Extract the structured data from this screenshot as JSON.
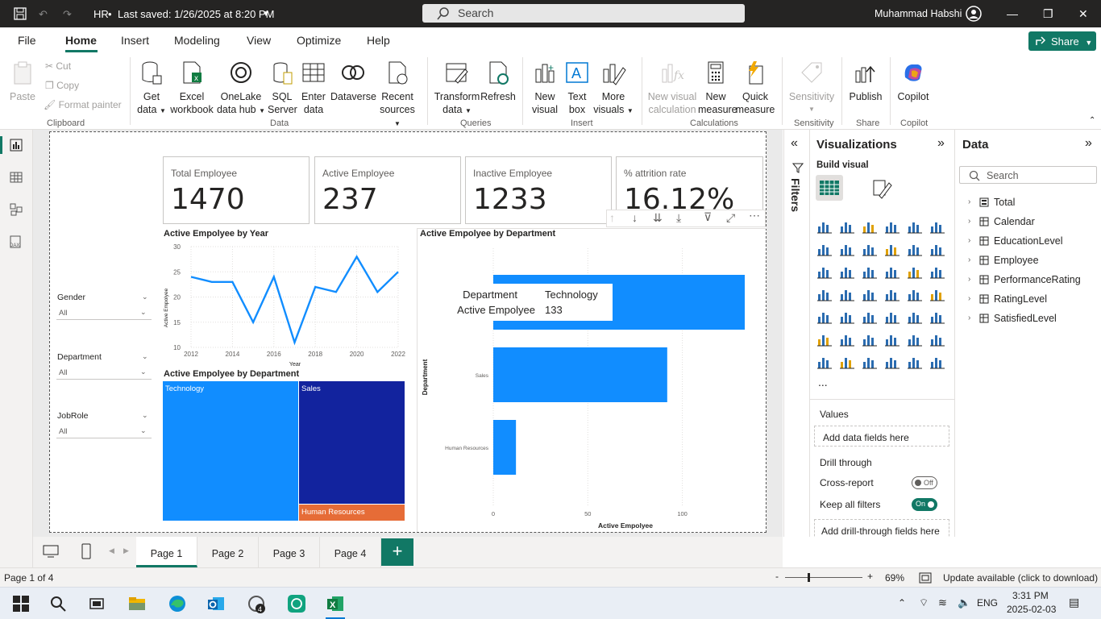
{
  "titlebar": {
    "file": "HR",
    "saved": "Last saved: 1/26/2025 at 8:20 PM",
    "search_placeholder": "Search",
    "user": "Muhammad Habshi"
  },
  "menu": {
    "tabs": [
      "File",
      "Home",
      "Insert",
      "Modeling",
      "View",
      "Optimize",
      "Help"
    ],
    "share": "Share"
  },
  "ribbon": {
    "clipboard": {
      "paste": "Paste",
      "cut": "Cut",
      "copy": "Copy",
      "format_painter": "Format painter",
      "group": "Clipboard"
    },
    "data": {
      "get_data": [
        "Get",
        "data"
      ],
      "excel": [
        "Excel",
        "workbook"
      ],
      "onelake": [
        "OneLake",
        "data hub"
      ],
      "sql": [
        "SQL",
        "Server"
      ],
      "enter": [
        "Enter",
        "data"
      ],
      "dataverse": "Dataverse",
      "recent": [
        "Recent",
        "sources"
      ],
      "group": "Data"
    },
    "queries": {
      "transform": [
        "Transform",
        "data"
      ],
      "refresh": "Refresh",
      "group": "Queries"
    },
    "insert": {
      "new_visual": [
        "New",
        "visual"
      ],
      "text_box": [
        "Text",
        "box"
      ],
      "more_visuals": [
        "More",
        "visuals"
      ],
      "group": "Insert"
    },
    "calculations": {
      "new_visual_calc": [
        "New visual",
        "calculation"
      ],
      "new_measure": [
        "New",
        "measure"
      ],
      "quick_measure": [
        "Quick",
        "measure"
      ],
      "group": "Calculations"
    },
    "sensitivity": {
      "label": "Sensitivity",
      "group": "Sensitivity"
    },
    "share": {
      "publish": "Publish",
      "group": "Share"
    },
    "copilot": {
      "label": "Copilot",
      "group": "Copilot"
    }
  },
  "cards": [
    {
      "label": "Total Employee",
      "value": "1470"
    },
    {
      "label": "Active Employee",
      "value": "237"
    },
    {
      "label": "Inactive Employee",
      "value": "1233"
    },
    {
      "label": "% attrition rate",
      "value": "16.12%"
    }
  ],
  "slicers": [
    {
      "label": "Gender",
      "value": "All"
    },
    {
      "label": "Department",
      "value": "All"
    },
    {
      "label": "JobRole",
      "value": "All"
    }
  ],
  "line_chart": {
    "title": "Active Empolyee by Year",
    "ylabel": "Active Empolyee",
    "xlabel": "Year",
    "x_ticks": [
      "2012",
      "2014",
      "2016",
      "2018",
      "2020",
      "2022"
    ],
    "y_ticks": [
      "10",
      "15",
      "20",
      "25",
      "30"
    ]
  },
  "treemap": {
    "title": "Active Empolyee by Department",
    "labels": [
      "Technology",
      "Sales",
      "Human Resources"
    ]
  },
  "bar_chart": {
    "title": "Active Empolyee by Department",
    "ylabel": "Department",
    "xlabel": "Active Empolyee",
    "categories": [
      "Sales",
      "Human Resources"
    ],
    "x_ticks": [
      "0",
      "50",
      "100"
    ],
    "tooltip": {
      "k1": "Department",
      "v1": "Technology",
      "k2": "Active Empolyee",
      "v2": "133"
    }
  },
  "chart_data": [
    {
      "type": "line",
      "title": "Active Empolyee by Year",
      "xlabel": "Year",
      "ylabel": "Active Empolyee",
      "x": [
        2012,
        2013,
        2014,
        2015,
        2016,
        2017,
        2018,
        2019,
        2020,
        2021,
        2022
      ],
      "values": [
        24,
        23,
        23,
        15,
        24,
        11,
        22,
        21,
        28,
        21,
        25
      ],
      "ylim": [
        10,
        30
      ]
    },
    {
      "type": "bar",
      "title": "Active Empolyee by Department",
      "xlabel": "Active Empolyee",
      "ylabel": "Department",
      "categories": [
        "Technology",
        "Sales",
        "Human Resources"
      ],
      "values": [
        133,
        92,
        12
      ],
      "xlim": [
        0,
        133
      ]
    },
    {
      "type": "treemap",
      "title": "Active Empolyee by Department",
      "categories": [
        "Technology",
        "Sales",
        "Human Resources"
      ],
      "values": [
        133,
        92,
        12
      ]
    }
  ],
  "filters_pane": {
    "label": "Filters"
  },
  "viz_pane": {
    "title": "Visualizations",
    "build": "Build visual",
    "values": "Values",
    "add_data": "Add data fields here",
    "drill": "Drill through",
    "cross_report": "Cross-report",
    "cross_state": "Off",
    "keep_filters": "Keep all filters",
    "keep_state": "On",
    "add_drill": "Add drill-through fields here",
    "more": "..."
  },
  "data_pane": {
    "title": "Data",
    "search_placeholder": "Search",
    "tables": [
      "Total",
      "Calendar",
      "EducationLevel",
      "Employee",
      "PerformanceRating",
      "RatingLevel",
      "SatisfiedLevel"
    ]
  },
  "pages": [
    "Page 1",
    "Page 2",
    "Page 3",
    "Page 4"
  ],
  "status": {
    "page": "Page 1 of 4",
    "zoom": "69%",
    "update": "Update available (click to download)"
  },
  "taskbar": {
    "lang": "ENG",
    "time": "3:31 PM",
    "date": "2025-02-03",
    "badge": "4"
  },
  "colors": {
    "accent": "#117865",
    "bar_blue": "#118dff",
    "navy": "#12239e",
    "orange": "#e66c37"
  }
}
